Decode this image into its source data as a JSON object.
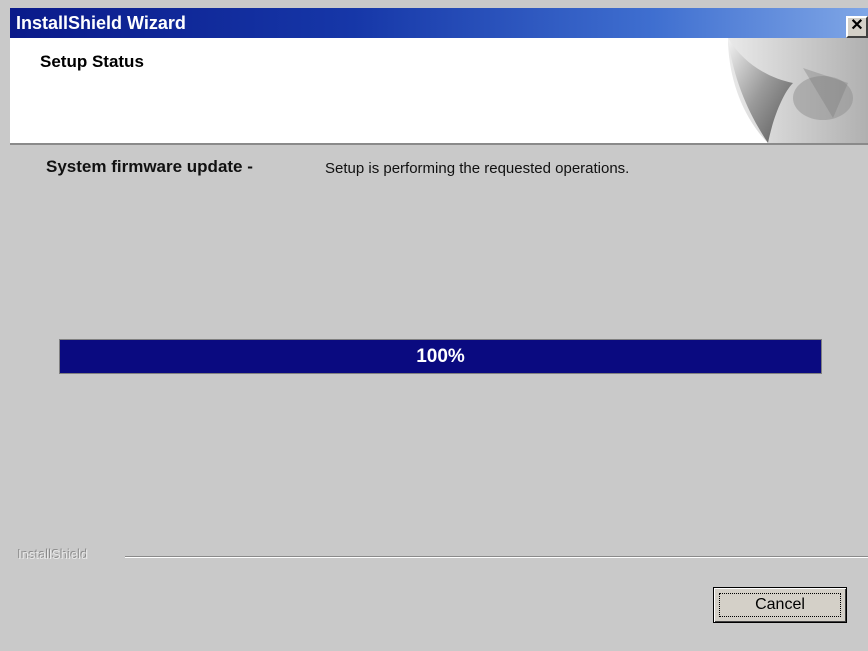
{
  "window": {
    "title": "InstallShield Wizard",
    "close_glyph": "✕",
    "titlebar_color": "#0a1a8a"
  },
  "header": {
    "heading": "Setup Status",
    "graphic_icon": "page-curl-graphic"
  },
  "body": {
    "task_label": "System firmware update -",
    "status_text": "Setup is performing the requested operations.",
    "progress": {
      "value": 1.0,
      "label": "100%",
      "fill_color": "#0a0a80"
    }
  },
  "footer": {
    "brand": "InstallShield",
    "cancel_label": "Cancel"
  }
}
